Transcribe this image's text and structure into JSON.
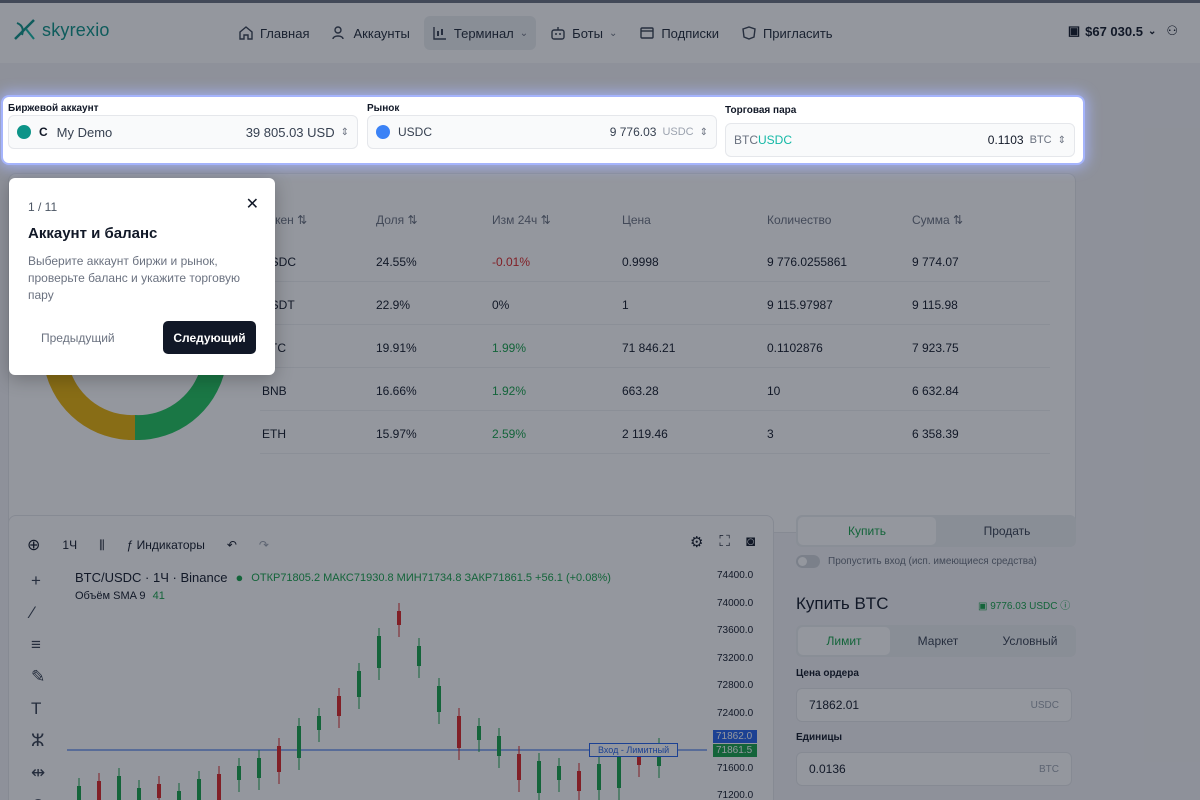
{
  "header": {
    "logo_text": "skyrexio",
    "nav": [
      {
        "label": "Главная",
        "icon": "home-icon"
      },
      {
        "label": "Аккаунты",
        "icon": "user-icon"
      },
      {
        "label": "Терминал",
        "icon": "terminal-chart-icon",
        "active": true,
        "dropdown": true
      },
      {
        "label": "Боты",
        "icon": "bot-icon",
        "dropdown": true
      },
      {
        "label": "Подписки",
        "icon": "subscription-icon"
      },
      {
        "label": "Пригласить",
        "icon": "gift-icon"
      }
    ],
    "balance": "$67 030.5",
    "accent": "#0d9488"
  },
  "selectors": {
    "account": {
      "label": "Биржевой аккаунт",
      "initial": "C",
      "name": "My Demo",
      "amount": "39 805.03 USD"
    },
    "market": {
      "label": "Рынок",
      "name": "USDC",
      "amount": "9 776.03",
      "unit": "USDC"
    },
    "pair": {
      "label": "Торговая пара",
      "base": "BTC",
      "quote": "USDC",
      "amount": "0.1103",
      "unit": "BTC"
    }
  },
  "assets": {
    "headers": [
      "Токен ⇅",
      "Доля ⇅",
      "Изм 24ч ⇅",
      "Цена",
      "Количество",
      "Сумма ⇅"
    ],
    "rows": [
      {
        "token": "USDC",
        "share": "24.55%",
        "change": "-0.01%",
        "change_color": "#dc2626",
        "price": "0.9998",
        "qty": "9 776.0255861",
        "sum": "9 774.07"
      },
      {
        "token": "USDT",
        "share": "22.9%",
        "change": "0%",
        "change_color": "#111827",
        "price": "1",
        "qty": "9 115.97987",
        "sum": "9 115.98"
      },
      {
        "token": "BTC",
        "share": "19.91%",
        "change": "1.99%",
        "change_color": "#16a34a",
        "price": "71 846.21",
        "qty": "0.1102876",
        "sum": "7 923.75"
      },
      {
        "token": "BNB",
        "share": "16.66%",
        "change": "1.92%",
        "change_color": "#16a34a",
        "price": "663.28",
        "qty": "10",
        "sum": "6 632.84"
      },
      {
        "token": "ETH",
        "share": "15.97%",
        "change": "2.59%",
        "change_color": "#16a34a",
        "price": "2 119.46",
        "qty": "3",
        "sum": "6 358.39"
      }
    ]
  },
  "chart_toolbar": {
    "interval": "1Ч",
    "indicators": "Индикаторы"
  },
  "chart_info": {
    "symbol": "BTC/USDC · 1Ч · Binance",
    "ohlc": "ОТКР71805.2 МАКС71930.8 МИН71734.8 ЗАКР71861.5 +56.1 (+0.08%)",
    "volume": "Объём SMA 9",
    "volume_value": "41",
    "price_ticks": [
      "74400.0",
      "74000.0",
      "73600.0",
      "73200.0",
      "72800.0",
      "72400.0",
      "72000.0",
      "71600.0",
      "71200.0"
    ],
    "entry_label": "Вход - Лимитный",
    "tag_order": "71862.0",
    "tag_last": "71861.5"
  },
  "order": {
    "tab_buy": "Купить",
    "tab_sell": "Продать",
    "skip_entry": "Пропустить вход (исп. имеющиеся средства)",
    "title": "Купить BTC",
    "available": "9776.03 USDC",
    "types": [
      "Лимит",
      "Маркет",
      "Условный"
    ],
    "price_label": "Цена ордера",
    "price_value": "71862.01",
    "price_unit": "USDC",
    "units_label": "Единицы",
    "units_value": "0.0136",
    "units_unit": "BTC"
  },
  "tour": {
    "step": "1 / 11",
    "title": "Аккаунт и баланс",
    "text": "Выберите аккаунт биржи и рынок, проверьте баланс и укажите торговую пару",
    "prev": "Предыдущий",
    "next": "Следующий"
  }
}
